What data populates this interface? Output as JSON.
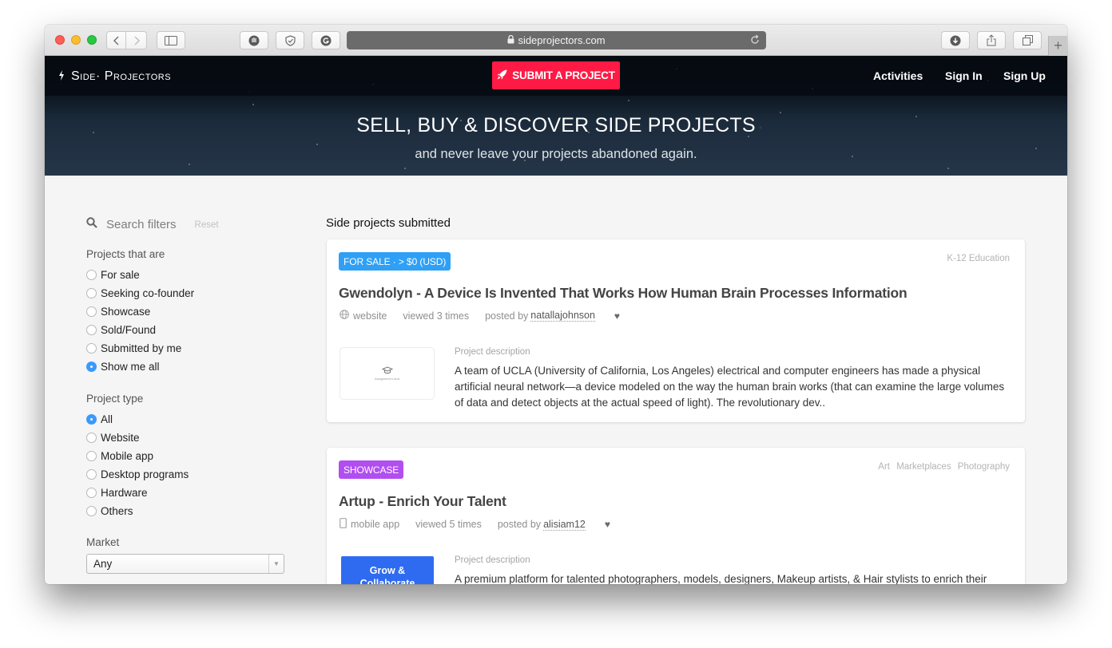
{
  "browser": {
    "url": "sideprojectors.com",
    "icons": {
      "back": "chevron-left-icon",
      "forward": "chevron-right-icon",
      "sidebar": "sidebar-icon",
      "extension1": "shield-hand-icon",
      "extension2": "shield-check-icon",
      "extension3": "grammarly-icon",
      "lock": "lock-icon",
      "reload": "reload-icon",
      "downloads": "download-icon",
      "share": "share-icon",
      "tabs": "tabs-icon",
      "new_tab": "plus-icon"
    },
    "new_tab_label": "+"
  },
  "nav": {
    "brand_icon": "bolt-icon",
    "brand": "Side· Projectors",
    "submit_label": "SUBMIT A PROJECT",
    "submit_icon": "rocket-icon",
    "links": [
      "Activities",
      "Sign In",
      "Sign Up"
    ]
  },
  "hero": {
    "title": "SELL, BUY & DISCOVER SIDE PROJECTS",
    "subtitle": "and never leave your projects abandoned again."
  },
  "colors": {
    "accent": "#ff1a45",
    "for_sale_badge": "#2fa0f5",
    "showcase_badge": "#b14ef0",
    "radio_checked": "#3b99fc"
  },
  "filters": {
    "search_label": "Search filters",
    "reset_label": "Reset",
    "status": {
      "label": "Projects that are",
      "options": [
        "For sale",
        "Seeking co-founder",
        "Showcase",
        "Sold/Found",
        "Submitted by me",
        "Show me all"
      ],
      "selected": "Show me all"
    },
    "type": {
      "label": "Project type",
      "options": [
        "All",
        "Website",
        "Mobile app",
        "Desktop programs",
        "Hardware",
        "Others"
      ],
      "selected": "All"
    },
    "market": {
      "label": "Market",
      "value": "Any"
    }
  },
  "main": {
    "section_title": "Side projects submitted",
    "projects": [
      {
        "badge": "FOR SALE · > $0 (USD)",
        "tags": [
          "K-12 Education"
        ],
        "title": "Gwendolyn - A Device Is Invented That Works How Human Brain Processes Information",
        "type_icon": "globe-icon",
        "type": "website",
        "views": "viewed 3 times",
        "posted_by_label": "posted by",
        "author": "natallajohnson",
        "thumbnail_caption": "Assignment Land",
        "desc_label": "Project description",
        "description": "A team of UCLA (University of California, Los Angeles) electrical and computer engineers has made a physical artificial neural network—a device modeled on the way the human brain works (that can examine the large volumes of data and detect objects at the actual speed of light). The revolutionary dev.."
      },
      {
        "badge": "SHOWCASE",
        "tags": [
          "Art",
          "Marketplaces",
          "Photography"
        ],
        "title": "Artup - Enrich Your Talent",
        "type_icon": "mobile-icon",
        "type": "mobile app",
        "views": "viewed 5 times",
        "posted_by_label": "posted by",
        "author": "alisiam12",
        "thumbnail_text": "Grow & Collaborate",
        "desc_label": "Project description",
        "description": "A premium platform for talented photographers, models, designers, Makeup artists, & Hair stylists to enrich their"
      }
    ]
  }
}
